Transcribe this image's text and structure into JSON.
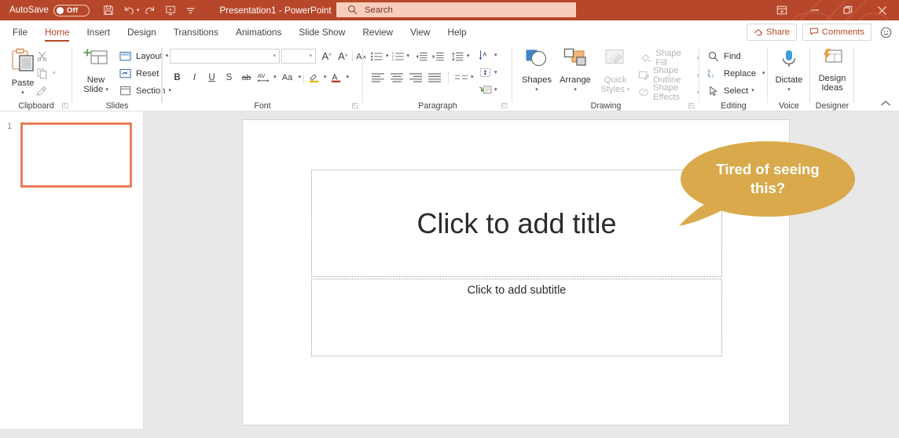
{
  "titlebar": {
    "autosave_label": "AutoSave",
    "autosave_state": "Off",
    "document_title": "Presentation1  -  PowerPoint",
    "quick_access": [
      {
        "name": "save-icon",
        "tooltip": "Save"
      },
      {
        "name": "undo-icon",
        "tooltip": "Undo"
      },
      {
        "name": "redo-icon",
        "tooltip": "Redo"
      },
      {
        "name": "start-presentation-icon",
        "tooltip": "Start From Beginning"
      },
      {
        "name": "customize-quick-access-toolbar-icon",
        "tooltip": "Customize Quick Access Toolbar"
      }
    ],
    "window_controls": [
      {
        "name": "ribbon-display-options-icon",
        "label": "Ribbon Display Options"
      },
      {
        "name": "minimize-icon",
        "label": "Minimize"
      },
      {
        "name": "restore-icon",
        "label": "Restore Down"
      },
      {
        "name": "close-icon",
        "label": "Close"
      }
    ],
    "accent_color": "#b7472a"
  },
  "search": {
    "placeholder": "Search",
    "value": "",
    "icon": "search-icon"
  },
  "tabs": [
    {
      "label": "File",
      "active": false
    },
    {
      "label": "Home",
      "active": true
    },
    {
      "label": "Insert",
      "active": false
    },
    {
      "label": "Design",
      "active": false
    },
    {
      "label": "Transitions",
      "active": false
    },
    {
      "label": "Animations",
      "active": false
    },
    {
      "label": "Slide Show",
      "active": false
    },
    {
      "label": "Review",
      "active": false
    },
    {
      "label": "View",
      "active": false
    },
    {
      "label": "Help",
      "active": false
    }
  ],
  "tab_actions": {
    "share_label": "Share",
    "comments_label": "Comments",
    "feedback_icon": "smiley-face-icon"
  },
  "ribbon": {
    "groups": [
      {
        "name": "clipboard",
        "label": "Clipboard",
        "has_launcher": true
      },
      {
        "name": "slides",
        "label": "Slides",
        "has_launcher": false
      },
      {
        "name": "font",
        "label": "Font",
        "has_launcher": true
      },
      {
        "name": "paragraph",
        "label": "Paragraph",
        "has_launcher": true
      },
      {
        "name": "drawing",
        "label": "Drawing",
        "has_launcher": true
      },
      {
        "name": "editing",
        "label": "Editing",
        "has_launcher": false
      },
      {
        "name": "voice",
        "label": "Voice",
        "has_launcher": false
      },
      {
        "name": "designer",
        "label": "Designer",
        "has_launcher": false
      }
    ],
    "clipboard": {
      "paste_label": "Paste",
      "cut_icon": "scissors-icon",
      "copy_icon": "copy-icon",
      "format_painter_icon": "format-painter-icon"
    },
    "slides": {
      "new_slide_label": "New Slide",
      "layout_label": "Layout",
      "reset_label": "Reset",
      "section_label": "Section"
    },
    "font": {
      "font_name_value": "",
      "font_size_value": "",
      "grow_font_label": "A",
      "shrink_font_label": "A",
      "clear_formatting_icon": "clear-formatting-icon",
      "bold_label": "B",
      "italic_label": "I",
      "underline_label": "U",
      "shadow_label": "S",
      "strikethrough_label": "ab",
      "character_spacing_label": "AV",
      "change_case_label": "Aa",
      "text_highlight_icon": "text-highlight-icon",
      "font_color_label": "A"
    },
    "paragraph": {
      "bullets_icon": "bullets-icon",
      "numbering_icon": "numbering-icon",
      "decrease_indent_icon": "decrease-indent-icon",
      "increase_indent_icon": "increase-indent-icon",
      "line_spacing_icon": "line-spacing-icon",
      "text_direction_icon": "text-direction-icon",
      "align_text_icon": "align-text-icon",
      "smartart_icon": "convert-to-smartart-icon",
      "align_left_icon": "align-left-icon",
      "align_center_icon": "align-center-icon",
      "align_right_icon": "align-right-icon",
      "justify_icon": "justify-icon",
      "columns_icon": "columns-icon"
    },
    "drawing": {
      "shapes_label": "Shapes",
      "arrange_label": "Arrange",
      "quick_styles_label": "Quick Styles",
      "shape_fill_label": "Shape Fill",
      "shape_outline_label": "Shape Outline",
      "shape_effects_label": "Shape Effects"
    },
    "editing": {
      "find_label": "Find",
      "replace_label": "Replace",
      "select_label": "Select"
    },
    "voice": {
      "dictate_label": "Dictate"
    },
    "designer": {
      "design_ideas_label": "Design Ideas"
    },
    "collapse_icon": "collapse-ribbon-chevron-icon"
  },
  "slide_panel": {
    "slide_number": "1",
    "selection_color": "#ed7d5b"
  },
  "slide": {
    "title_placeholder": "Click to add title",
    "subtitle_placeholder": "Click to add subtitle"
  },
  "callout": {
    "text": "Tired of seeing this?",
    "color": "#d9a94c",
    "text_color": "#ffffff"
  }
}
